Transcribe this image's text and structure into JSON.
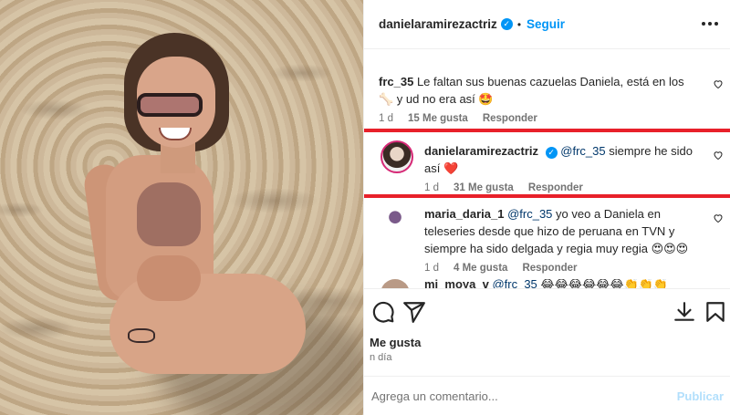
{
  "header": {
    "username": "danielaramirezactriz",
    "follow_label": "Seguir"
  },
  "comments": [
    {
      "user": "frc_35",
      "text": "Le faltan sus buenas cazuelas Daniela, está en los 🦴 y ud no era así 🤩",
      "time": "1 d",
      "likes": "15 Me gusta",
      "reply": "Responder"
    },
    {
      "user": "danielaramirezactriz",
      "mention": "@frc_35",
      "text": "siempre he sido así ❤️",
      "time": "1 d",
      "likes": "31 Me gusta",
      "reply": "Responder"
    },
    {
      "user": "maria_daria_1",
      "mention": "@frc_35",
      "text": "yo veo a Daniela en teleseries desde que hizo de peruana en TVN y siempre ha sido delgada y regia muy regia 😍😍😍",
      "time": "1 d",
      "likes": "4 Me gusta",
      "reply": "Responder"
    },
    {
      "user": "mi_moya_v",
      "mention": "@frc_35",
      "text": "😂😂😂😂😂😂👏👏👏"
    }
  ],
  "footer": {
    "likes_label": "Me gusta",
    "ago": "n día",
    "comment_placeholder": "Agrega un comentario...",
    "post_label": "Publicar"
  },
  "colors": {
    "accent_blue": "#0095f6",
    "highlight_red": "#e8202a",
    "muted": "#737373"
  },
  "icons": [
    "verified-badge-icon",
    "more-options-icon",
    "heart-icon",
    "comment-icon",
    "share-icon",
    "download-icon",
    "bookmark-icon"
  ]
}
